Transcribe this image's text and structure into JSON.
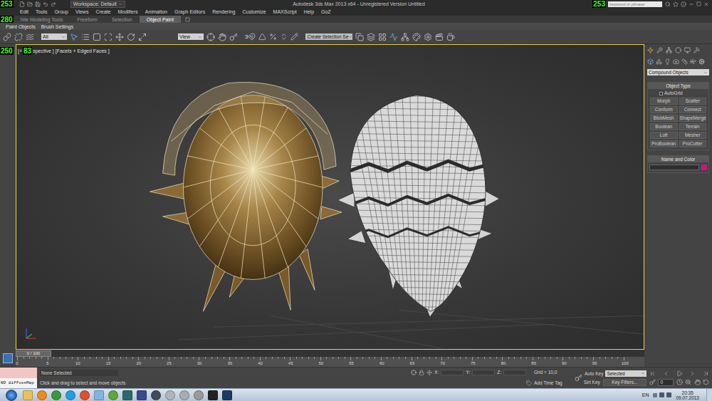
{
  "window": {
    "title": "Autodesk 3ds Max 2013 x64 - Unregistered Version Untitled"
  },
  "title_bar": {
    "counter_left": "253",
    "workspace": "Workspace: Default",
    "counter_right": "253",
    "search": {
      "placeholder": "keyword or phrase"
    }
  },
  "menu": [
    "Edit",
    "Tools",
    "Group",
    "Views",
    "Create",
    "Modifiers",
    "Animation",
    "Graph Editors",
    "Rendering",
    "Customize",
    "MAXScript",
    "Help",
    "GoZ"
  ],
  "ribbon": {
    "counter": "280",
    "tabs": [
      {
        "label": "hite Modeling Tools",
        "selected": false
      },
      {
        "label": "Freeform",
        "selected": false
      },
      {
        "label": "Selection",
        "selected": false
      },
      {
        "label": "Object Paint",
        "selected": true
      }
    ],
    "panels": [
      "Paint Objects",
      "Brush Settings"
    ]
  },
  "toolbar": {
    "selection_filter": "All",
    "reference_coord": "View",
    "snap_label": "3",
    "named_selection": "Create Selection Se"
  },
  "viewport": {
    "counter": "250",
    "label_start": "[+",
    "label_counter": "83",
    "label_end": "spective ] [Facets + Edged Faces ]",
    "active": true
  },
  "command_panel": {
    "category": "Compound Objects",
    "object_type": {
      "title": "Object Type",
      "autogrid": {
        "label": "AutoGrid",
        "checked": false
      },
      "buttons": [
        "Morph",
        "Scatter",
        "Conform",
        "Connect",
        "BlobMesh",
        "ShapeMerge",
        "Boolean",
        "Terrain",
        "Loft",
        "Mesher",
        "ProBoolean",
        "ProCutter"
      ]
    },
    "name_and_color": {
      "title": "Name and Color",
      "name": "",
      "color": "#c8187e"
    }
  },
  "timeline": {
    "slider": "0 / 100",
    "level": 0,
    "ticks": [
      "0",
      "5",
      "10",
      "15",
      "20",
      "25",
      "30",
      "35",
      "40",
      "45",
      "50",
      "55",
      "60",
      "65",
      "70",
      "75",
      "80",
      "85",
      "90",
      "95",
      "100"
    ]
  },
  "status_bar": {
    "listener": "NO diffuseMap",
    "selection": "None Selected",
    "prompt": "Click and drag to select and move objects",
    "x_label": "X:",
    "y_label": "Y:",
    "z_label": "Z:",
    "grid": "Grid = 10,0",
    "add_time_tag": "Add Time Tag",
    "auto_key": {
      "label": "Auto Key",
      "on": false
    },
    "key_mode": "Selected",
    "set_key": "Set Key",
    "key_filters": "Key Filters...",
    "frame": "0"
  },
  "taskbar": {
    "language": "EN",
    "time": "20:35",
    "date": "09.07.2013"
  }
}
